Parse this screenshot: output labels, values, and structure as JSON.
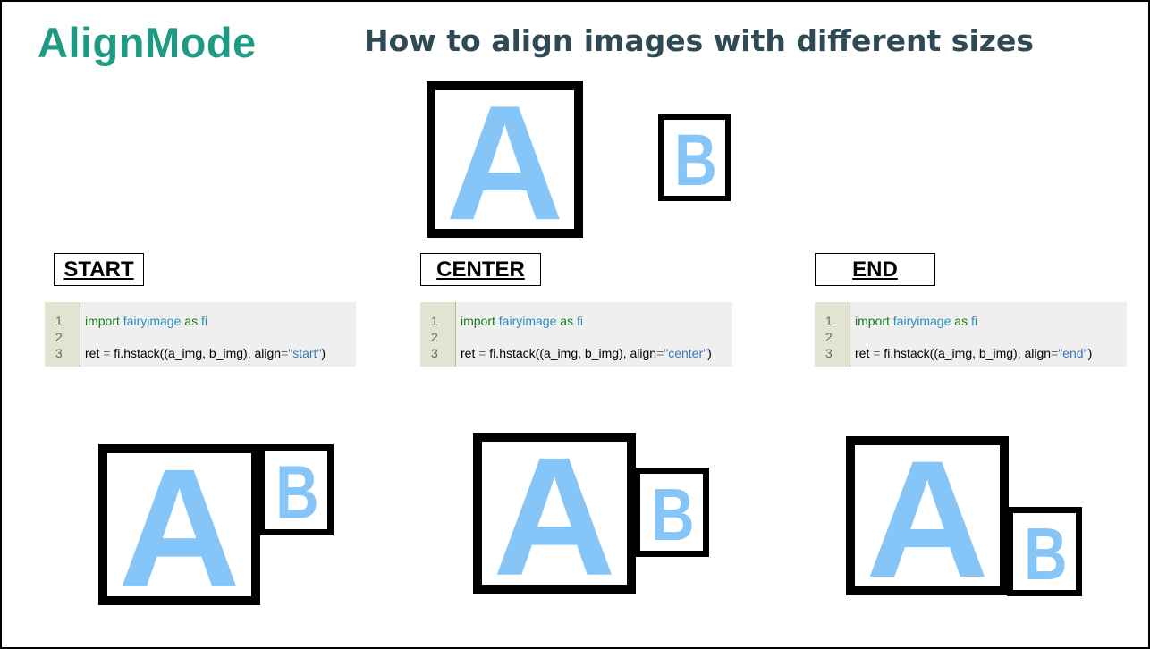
{
  "brand": "AlignMode",
  "headline": "How to align images with different sizes",
  "sample": {
    "a_letter": "A",
    "b_letter": "B"
  },
  "letter_color": "#86c5f7",
  "modes": [
    {
      "label": "START",
      "code": {
        "n1": "1",
        "n2": "2",
        "n3": "3",
        "kw_import": "import",
        "module": "fairyimage",
        "kw_as": "as",
        "alias": "fi",
        "l3_prefix": "ret ",
        "eq1": "=",
        "l3_call": " fi.hstack((a_img, b_img), align",
        "eq2": "=",
        "l3_string": "\"start\"",
        "l3_close": ")"
      },
      "result": {
        "a_letter": "A",
        "b_letter": "B"
      }
    },
    {
      "label": "CENTER",
      "code": {
        "n1": "1",
        "n2": "2",
        "n3": "3",
        "kw_import": "import",
        "module": "fairyimage",
        "kw_as": "as",
        "alias": "fi",
        "l3_prefix": "ret ",
        "eq1": "=",
        "l3_call": " fi.hstack((a_img, b_img), align",
        "eq2": "=",
        "l3_string": "\"center\"",
        "l3_close": ")"
      },
      "result": {
        "a_letter": "A",
        "b_letter": "B"
      }
    },
    {
      "label": "END",
      "code": {
        "n1": "1",
        "n2": "2",
        "n3": "3",
        "kw_import": "import",
        "module": "fairyimage",
        "kw_as": "as",
        "alias": "fi",
        "l3_prefix": "ret ",
        "eq1": "=",
        "l3_call": " fi.hstack((a_img, b_img), align",
        "eq2": "=",
        "l3_string": "\"end\"",
        "l3_close": ")"
      },
      "result": {
        "a_letter": "A",
        "b_letter": "B"
      }
    }
  ]
}
